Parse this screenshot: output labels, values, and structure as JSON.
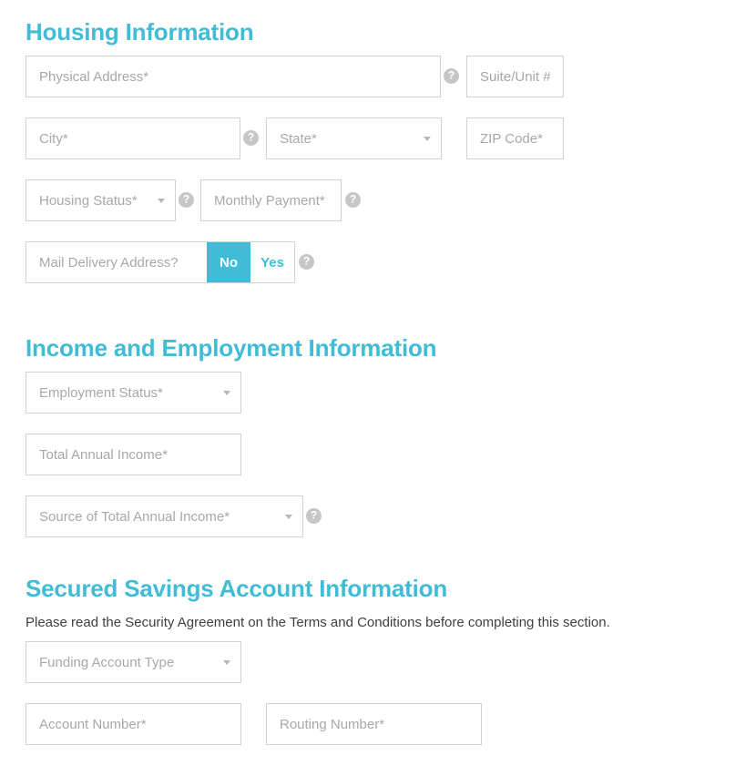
{
  "sections": [
    {
      "id": "housing",
      "title": "Housing Information",
      "fields": {
        "physical_address": "Physical Address*",
        "suite_unit": "Suite/Unit #",
        "city": "City*",
        "state": "State*",
        "zip_code": "ZIP Code*",
        "housing_status": "Housing Status*",
        "monthly_payment": "Monthly Payment*",
        "mail_delivery": "Mail Delivery Address?"
      },
      "toggle": {
        "no_label": "No",
        "yes_label": "Yes",
        "selected": "No"
      }
    },
    {
      "id": "income",
      "title": "Income and Employment Information",
      "fields": {
        "employment_status": "Employment Status*",
        "total_annual_income": "Total Annual Income*",
        "source_of_income": "Source of Total Annual Income*"
      }
    },
    {
      "id": "savings",
      "title": "Secured Savings Account Information",
      "note": "Please read the Security Agreement on the Terms and Conditions before completing this section.",
      "fields": {
        "funding_account_type": "Funding Account Type",
        "account_number": "Account Number*",
        "routing_number": "Routing Number*"
      }
    }
  ],
  "icons": {
    "help_glyph": "?",
    "help_name": "help-icon"
  },
  "colors": {
    "accent": "#41bcd6",
    "border": "#d2d2d2",
    "placeholder": "#a8a8a8",
    "help_badge": "#c6c6c6",
    "note_text": "#3f3f3f"
  }
}
